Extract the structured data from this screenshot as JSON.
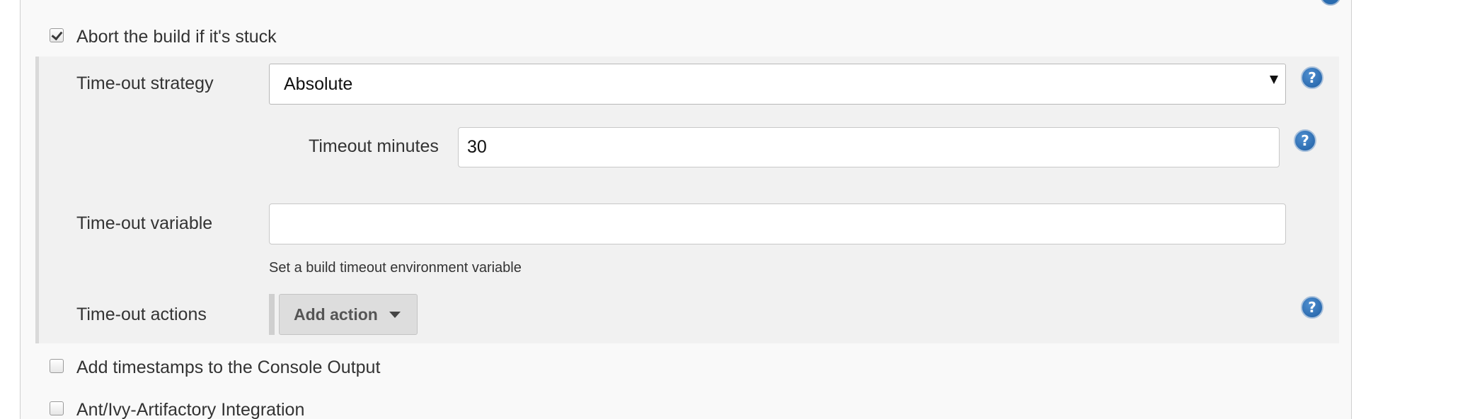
{
  "options": {
    "abort_stuck": {
      "label": "Abort the build if it's stuck",
      "checked": true
    },
    "add_timestamps": {
      "label": "Add timestamps to the Console Output",
      "checked": false
    },
    "ant_ivy": {
      "label": "Ant/Ivy-Artifactory Integration",
      "checked": false
    }
  },
  "timeout": {
    "strategy_label": "Time-out strategy",
    "strategy_value": "Absolute",
    "minutes_label": "Timeout minutes",
    "minutes_value": "30",
    "variable_label": "Time-out variable",
    "variable_value": "",
    "variable_hint": "Set a build timeout environment variable",
    "actions_label": "Time-out actions",
    "add_action_label": "Add action"
  },
  "icons": {
    "help": "help-icon",
    "help_glyph": "?",
    "dropdown": "chevron-down-icon",
    "checkbox": "checkbox"
  },
  "colors": {
    "help_blue": "#2a6cb0",
    "panel_bg": "#f9f9f9",
    "nested_bg": "#f1f1f1",
    "button_bg": "#dddddd"
  }
}
